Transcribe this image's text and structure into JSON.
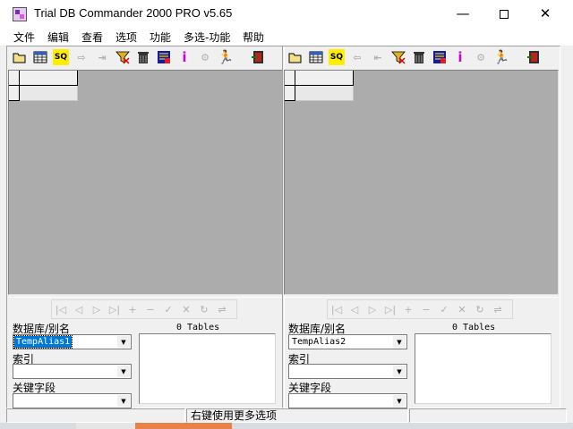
{
  "window": {
    "title": "Trial DB Commander 2000 PRO v5.65",
    "minimize": "—",
    "close": "✕"
  },
  "menu": [
    "文件",
    "编辑",
    "查看",
    "选项",
    "功能",
    "多选-功能",
    "帮助"
  ],
  "toolbar_icons": [
    "open-folder-icon",
    "table-grid-icon",
    "sql-icon",
    "copy-arrow-icon",
    "transfer-icon",
    "filter-icon",
    "delete-trash-icon",
    "database-icon",
    "info-icon",
    "tools-icon",
    "run-icon",
    "exit-icon"
  ],
  "panes": [
    {
      "alias_label": "数据库/别名",
      "alias_value": "TempAlias1",
      "alias_selected": true,
      "index_label": "索引",
      "keyfield_label": "关键字段",
      "tables_label": "0 Tables"
    },
    {
      "alias_label": "数据库/别名",
      "alias_value": "TempAlias2",
      "alias_selected": false,
      "index_label": "索引",
      "keyfield_label": "关键字段",
      "tables_label": "0 Tables"
    }
  ],
  "status": {
    "hint": "右键使用更多选项"
  },
  "taskbar": {
    "peek_colors": [
      "#e6e6e6",
      "#e8814a"
    ]
  }
}
